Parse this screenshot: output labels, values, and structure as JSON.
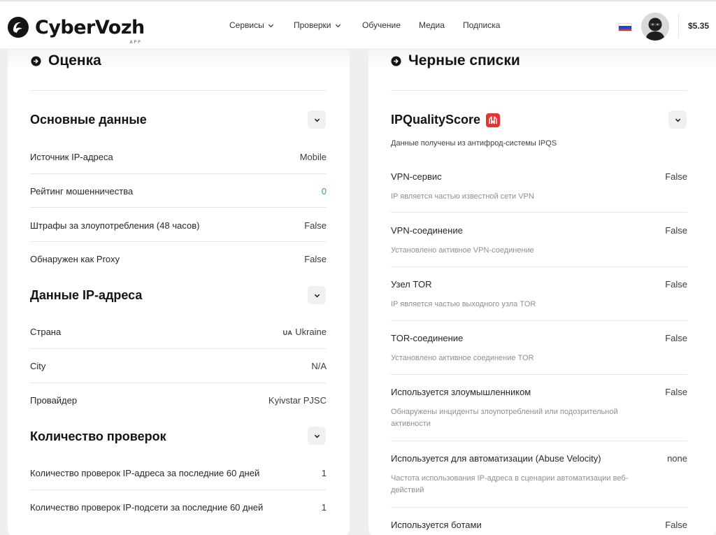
{
  "header": {
    "logo_text": "CyberVozh",
    "logo_sub": "APP",
    "nav": [
      {
        "label": "Сервисы",
        "has_dropdown": true
      },
      {
        "label": "Проверки",
        "has_dropdown": true
      },
      {
        "label": "Обучение",
        "has_dropdown": false
      },
      {
        "label": "Медиа",
        "has_dropdown": false
      },
      {
        "label": "Подписка",
        "has_dropdown": false
      }
    ],
    "language_flag": "ru-flag-icon",
    "balance": "$5.35"
  },
  "left": {
    "title": "Оценка",
    "groups": [
      {
        "title": "Основные данные",
        "rows": [
          {
            "label": "Источник IP-адреса",
            "value": "Mobile"
          },
          {
            "label": "Рейтинг мошенничества",
            "value": "0"
          },
          {
            "label": "Штрафы за злоупотребления (48 часов)",
            "value": "False"
          },
          {
            "label": "Обнаружен как Proxy",
            "value": "False"
          }
        ]
      },
      {
        "title": "Данные IP-адреса",
        "rows": [
          {
            "label": "Страна",
            "country_code": "UA",
            "value": "Ukraine"
          },
          {
            "label": "City",
            "value": "N/A"
          },
          {
            "label": "Провайдер",
            "value": "Kyivstar PJSC"
          }
        ]
      },
      {
        "title": "Количество проверок",
        "rows": [
          {
            "label": "Количество проверок IP-адреса за последние 60 дней",
            "value": "1"
          },
          {
            "label": "Количество проверок IP-подсети за последние 60 дней",
            "value": "1"
          }
        ]
      }
    ]
  },
  "right": {
    "title": "Черные списки",
    "provider": {
      "name": "IPQualityScore",
      "note": "Данные получены из антифрод-системы IPQS",
      "rows": [
        {
          "label": "VPN-сервис",
          "value": "False",
          "desc": "IP является частью известной сети VPN"
        },
        {
          "label": "VPN-соединение",
          "value": "False",
          "desc": "Установлено активное VPN-соединение"
        },
        {
          "label": "Узел TOR",
          "value": "False",
          "desc": "IP является частью выходного узла TOR"
        },
        {
          "label": "TOR-соединение",
          "value": "False",
          "desc": "Установлено активное соединение TOR"
        },
        {
          "label": "Используется злоумышленником",
          "value": "False",
          "desc": "Обнаружены инциденты злоупотреблений или подозрительной активности"
        },
        {
          "label": "Используется для автоматизации (Abuse Velocity)",
          "value": "none",
          "desc": "Частота использования IP-адреса в сценарии автоматизации веб-действий"
        },
        {
          "label": "Используется ботами",
          "value": "False",
          "desc": ""
        }
      ]
    }
  },
  "colors": {
    "accent_green": "#1fbd3d",
    "ipqs_red": "#e8322f",
    "page_bg": "#eeeff1"
  }
}
